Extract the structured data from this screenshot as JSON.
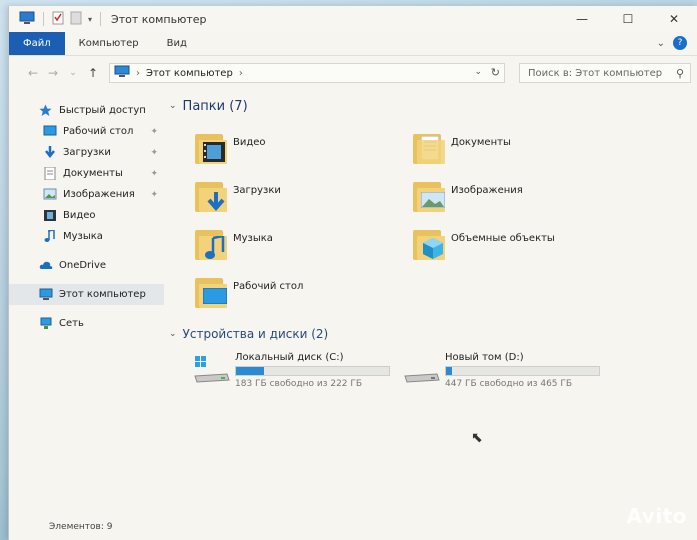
{
  "window": {
    "title": "Этот компьютер"
  },
  "ribbon": {
    "tabs": [
      "Файл",
      "Компьютер",
      "Вид"
    ],
    "active_tab": "Файл"
  },
  "address": {
    "path": "Этот компьютер"
  },
  "search": {
    "placeholder": "Поиск в: Этот компьютер"
  },
  "sidebar": {
    "quick_access": "Быстрый доступ",
    "items": [
      {
        "label": "Рабочий стол",
        "icon": "desktop-icon",
        "pinned": true
      },
      {
        "label": "Загрузки",
        "icon": "download-icon",
        "pinned": true
      },
      {
        "label": "Документы",
        "icon": "document-icon",
        "pinned": true
      },
      {
        "label": "Изображения",
        "icon": "image-icon",
        "pinned": true
      },
      {
        "label": "Видео",
        "icon": "video-icon",
        "pinned": false
      },
      {
        "label": "Музыка",
        "icon": "music-icon",
        "pinned": false
      }
    ],
    "onedrive": "OneDrive",
    "this_pc": "Этот компьютер",
    "network": "Сеть"
  },
  "content": {
    "folders_header": "Папки (7)",
    "folders": [
      {
        "name": "Видео",
        "icon": "video-folder-icon"
      },
      {
        "name": "Документы",
        "icon": "documents-folder-icon"
      },
      {
        "name": "Загрузки",
        "icon": "downloads-folder-icon"
      },
      {
        "name": "Изображения",
        "icon": "pictures-folder-icon"
      },
      {
        "name": "Музыка",
        "icon": "music-folder-icon"
      },
      {
        "name": "Объемные объекты",
        "icon": "3d-objects-folder-icon"
      },
      {
        "name": "Рабочий стол",
        "icon": "desktop-folder-icon"
      }
    ],
    "drives_header": "Устройства и диски (2)",
    "drives": [
      {
        "name": "Локальный диск (C:)",
        "free": "183 ГБ свободно из 222 ГБ",
        "used_fraction": 0.18
      },
      {
        "name": "Новый том (D:)",
        "free": "447 ГБ свободно из 465 ГБ",
        "used_fraction": 0.04
      }
    ]
  },
  "status": {
    "items_count": "Элементов: 9"
  },
  "watermark": "Avito",
  "colors": {
    "accent": "#1a5fb4",
    "folder": "#f2d27a",
    "drive_bar": "#2a8ad4"
  }
}
